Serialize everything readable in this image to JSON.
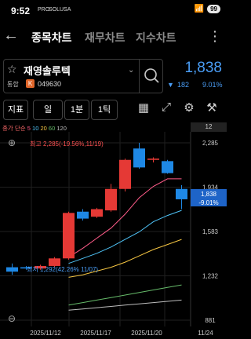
{
  "status_bar": {
    "time": "9:52",
    "mini_labels": [
      "PRO",
      "SOL",
      "USA"
    ],
    "battery": "99"
  },
  "header": {
    "tabs": [
      "종목차트",
      "재무차트",
      "지수차트"
    ],
    "active_tab": 0
  },
  "stock": {
    "name": "재영솔루텍",
    "market_label": "통합",
    "code": "049630",
    "price": "1,838",
    "change_arrow": "▼",
    "change": "182",
    "change_pct": "9.01%"
  },
  "toolbar": {
    "buttons": [
      "지표",
      "일",
      "1분",
      "1틱"
    ],
    "icons": [
      "grid-icon",
      "expand-icon",
      "gear-icon",
      "tools-icon"
    ]
  },
  "chart_legend": {
    "prefix": "종가 단순",
    "periods": [
      "5",
      "10",
      "20",
      "60",
      "120"
    ],
    "colors": [
      "#ff5c8a",
      "#4fc3f7",
      "#f5c542",
      "#66bb6a",
      "#bdbdbd"
    ]
  },
  "chart_data": {
    "type": "candlestick",
    "y_axis_right": [
      "12",
      "2,285",
      "1,934",
      "1,583",
      "1,232",
      "881"
    ],
    "x_labels": [
      "2025/11/12",
      "2025/11/17",
      "2025/11/20",
      "11/24"
    ],
    "annotations": {
      "high": "최고 2,285(-19.56%,11/19)",
      "low": "최저 1,292(42.26% 11/07)"
    },
    "current_price_label": "1,838",
    "current_change_label": "-9.01%",
    "candles": [
      {
        "o": 1300,
        "c": 1265,
        "h": 1330,
        "l": 1240
      },
      {
        "o": 1300,
        "c": 1290,
        "h": 1310,
        "l": 1280
      },
      {
        "o": 1290,
        "c": 1310,
        "h": 1320,
        "l": 1280
      },
      {
        "o": 1310,
        "c": 1370,
        "h": 1380,
        "l": 1300
      },
      {
        "o": 1370,
        "c": 1730,
        "h": 1740,
        "l": 1360
      },
      {
        "o": 1740,
        "c": 1685,
        "h": 1760,
        "l": 1670
      },
      {
        "o": 1700,
        "c": 1760,
        "h": 1770,
        "l": 1690
      },
      {
        "o": 1750,
        "c": 1920,
        "h": 1960,
        "l": 1740
      },
      {
        "o": 1920,
        "c": 2150,
        "h": 2160,
        "l": 1900
      },
      {
        "o": 2240,
        "c": 2090,
        "h": 2285,
        "l": 2080
      },
      {
        "o": 2150,
        "c": 2160,
        "h": 2170,
        "l": 2130
      },
      {
        "o": 2140,
        "c": 2045,
        "h": 2150,
        "l": 2040
      },
      {
        "o": 1920,
        "c": 1838,
        "h": 1950,
        "l": 1760
      }
    ],
    "ma": {
      "5": [
        null,
        null,
        null,
        null,
        1380,
        1450,
        1530,
        1610,
        1720,
        1850,
        1940,
        2000,
        2000
      ],
      "10": [
        null,
        null,
        null,
        null,
        1330,
        1370,
        1410,
        1460,
        1520,
        1580,
        1660,
        1710,
        1750
      ],
      "20": [
        null,
        null,
        null,
        null,
        1220,
        1240,
        1270,
        1300,
        1340,
        1390,
        1440,
        1480,
        1520
      ],
      "60": [
        null,
        null,
        null,
        null,
        1000,
        1020,
        1040,
        1060,
        1080,
        1100,
        1120,
        1140,
        1160
      ],
      "120": [
        null,
        null,
        null,
        null,
        960,
        970,
        980,
        990,
        1000,
        1010,
        1020,
        1030,
        1040
      ]
    }
  }
}
